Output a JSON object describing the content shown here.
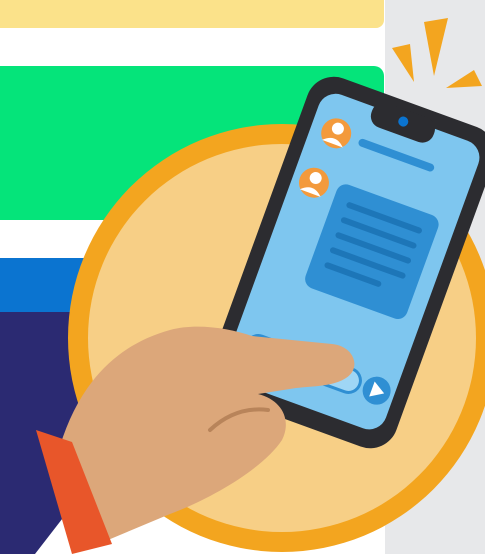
{
  "colors": {
    "background": "#ffffff",
    "side_panel": "#e7e8ea",
    "banner_yellow": "#fbe28a",
    "banner_green": "#05e47a",
    "banner_blue": "#0b74d0",
    "banner_navy": "#2b2a72",
    "circle_ring": "#f3a51f",
    "circle_fill": "#f7cf86",
    "phone_body": "#2c2c30",
    "phone_screen": "#7ec6ef",
    "chat_bubble": "#2f8fd3",
    "avatar_bg": "#f39a3c",
    "skin": "#dca77a",
    "sleeve": "#e8562a",
    "notify_rays": "#f3a51f"
  },
  "icons": {
    "notification": "notification-rays-icon",
    "send": "send-arrow-icon",
    "avatar": "user-avatar-icon"
  }
}
